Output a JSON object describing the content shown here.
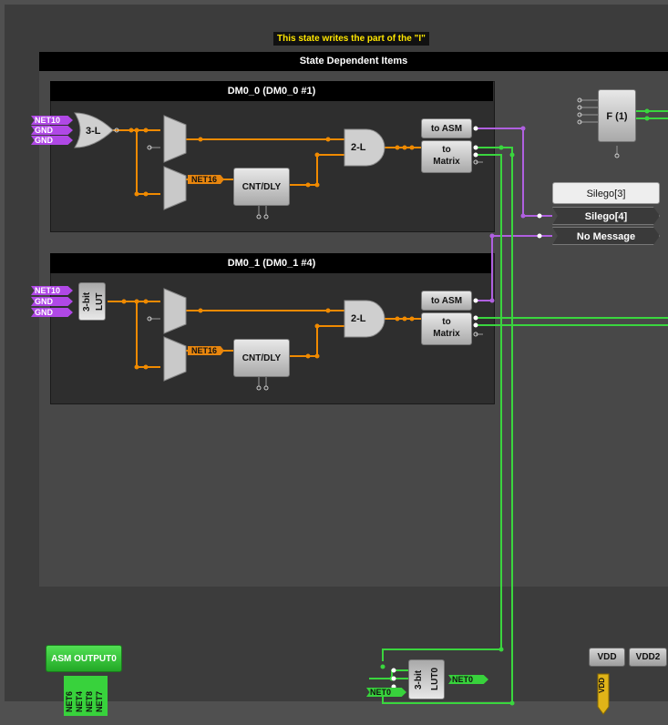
{
  "tooltip": "This state writes the part of the \"I\"",
  "state_items_title": "State Dependent Items",
  "dm0": {
    "title": "DM0_0 (DM0_0 #1)",
    "inputs": [
      "NET10",
      "GND",
      "GND"
    ],
    "gate": "3-L",
    "net_tag": "NET16",
    "cnt": "CNT/DLY",
    "and": "2-L",
    "to_asm": "to ASM",
    "to_matrix_1": "to",
    "to_matrix_2": "Matrix"
  },
  "dm1": {
    "title": "DM0_1 (DM0_1 #4)",
    "inputs": [
      "NET10",
      "GND",
      "GND"
    ],
    "lut": "3-bit LUT",
    "net_tag": "NET16",
    "cnt": "CNT/DLY",
    "and": "2-L",
    "to_asm": "to ASM",
    "to_matrix_1": "to",
    "to_matrix_2": "Matrix"
  },
  "f_block": "F (1)",
  "messages": {
    "header": "Silego[3]",
    "selected": "Silego[4]",
    "none": "No Message"
  },
  "asm_output": {
    "label": "ASM OUTPUT0",
    "nets": [
      "NET6",
      "NET4",
      "NET8",
      "NET7"
    ]
  },
  "lut0": {
    "label": "3-bit LUT0",
    "out_tag": "NET0",
    "in_tag": "NET0"
  },
  "vdd": "VDD",
  "vdd2": "VDD2",
  "vdd_tag": "VDD",
  "colors": {
    "orange_wire": "#f08a00",
    "purple_wire": "#b060e0",
    "green_wire": "#3ad63e",
    "tooltip_text": "#ffe600"
  }
}
